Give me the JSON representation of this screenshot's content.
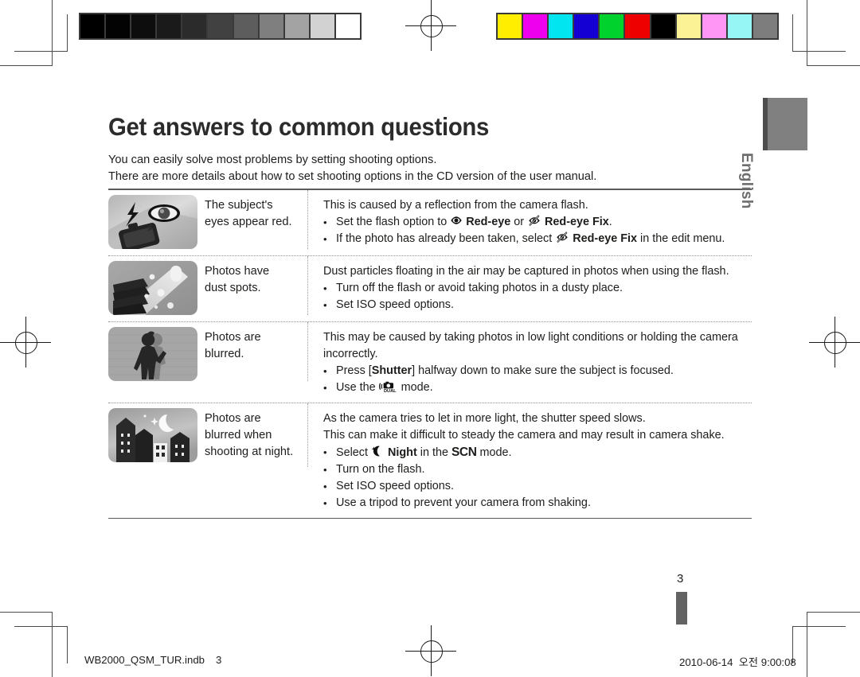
{
  "document": {
    "title": "Get answers to common questions",
    "intro_lines": [
      "You can easily solve most problems by setting shooting options.",
      "There are more details about how to set shooting options in the CD version of the user manual."
    ],
    "page_number": "3",
    "side_tab_label": "English"
  },
  "footer": {
    "filename": "WB2000_QSM_TUR.indb",
    "file_page": "3",
    "date": "2010-06-14",
    "meridiem": "오전",
    "time": "9:00:08"
  },
  "calibration": {
    "grayscale_label": "grayscale-calibration-strip",
    "grayscale_patches": [
      "#000000",
      "#030303",
      "#0d0d0d",
      "#1a1a1a",
      "#2b2b2b",
      "#414141",
      "#5d5d5d",
      "#7f7f7f",
      "#a3a3a3",
      "#d2d2d2",
      "#ffffff"
    ],
    "color_label": "color-calibration-strip",
    "color_patches": [
      "#ffee00",
      "#ee00ee",
      "#00e5f0",
      "#1400d2",
      "#00d22d",
      "#ee0000",
      "#000000",
      "#fbf295",
      "#ff96f5",
      "#96f5f5",
      "#7d7d7d"
    ]
  },
  "table": {
    "rows": [
      {
        "icon_name": "red-eye-photo-thumbnail",
        "label": [
          "The subject's",
          "eyes appear red."
        ],
        "lead": "This is caused by a reflection from the camera flash.",
        "bullets": [
          {
            "parts": [
              {
                "t": "text",
                "v": "Set the flash option to "
              },
              {
                "t": "icon",
                "v": "red-eye-icon"
              },
              {
                "t": "bold",
                "v": "Red-eye"
              },
              {
                "t": "text",
                "v": " or "
              },
              {
                "t": "icon",
                "v": "red-eye-fix-icon"
              },
              {
                "t": "bold",
                "v": "Red-eye Fix"
              },
              {
                "t": "text",
                "v": "."
              }
            ]
          },
          {
            "parts": [
              {
                "t": "text",
                "v": "If the photo has already been taken, select "
              },
              {
                "t": "icon",
                "v": "red-eye-fix-icon"
              },
              {
                "t": "bold",
                "v": "Red-eye Fix"
              },
              {
                "t": "text",
                "v": " in the edit menu."
              }
            ]
          }
        ]
      },
      {
        "icon_name": "dust-spots-photo-thumbnail",
        "label": [
          "Photos have",
          "dust spots."
        ],
        "lead": "Dust particles floating in the air may be captured in photos when using the flash.",
        "bullets": [
          {
            "parts": [
              {
                "t": "text",
                "v": "Turn off the flash or avoid taking photos in a dusty place."
              }
            ]
          },
          {
            "parts": [
              {
                "t": "text",
                "v": "Set ISO speed options."
              }
            ]
          }
        ]
      },
      {
        "icon_name": "blurred-photo-thumbnail",
        "label": [
          "Photos are",
          "blurred."
        ],
        "lead": "This may be caused by taking photos in low light conditions or holding the camera",
        "lead2": "incorrectly.",
        "bullets": [
          {
            "parts": [
              {
                "t": "text",
                "v": "Press ["
              },
              {
                "t": "bold",
                "v": "Shutter"
              },
              {
                "t": "text",
                "v": "] halfway down to make sure the subject is focused."
              }
            ]
          },
          {
            "parts": [
              {
                "t": "text",
                "v": "Use the "
              },
              {
                "t": "icon",
                "v": "dual-is-icon"
              },
              {
                "t": "text",
                "v": " mode."
              }
            ]
          }
        ]
      },
      {
        "icon_name": "night-scene-photo-thumbnail",
        "label": [
          "Photos are",
          "blurred when",
          "shooting at night."
        ],
        "lead": "As the camera tries to let in more light, the shutter speed slows.",
        "lead2": "This can make it difficult to steady the camera and may result in camera shake.",
        "bullets": [
          {
            "parts": [
              {
                "t": "text",
                "v": "Select "
              },
              {
                "t": "icon",
                "v": "night-mode-icon"
              },
              {
                "t": "bold",
                "v": "Night"
              },
              {
                "t": "text",
                "v": " in the "
              },
              {
                "t": "scn",
                "v": "SCN"
              },
              {
                "t": "text",
                "v": " mode."
              }
            ]
          },
          {
            "parts": [
              {
                "t": "text",
                "v": "Turn on the flash."
              }
            ]
          },
          {
            "parts": [
              {
                "t": "text",
                "v": "Set ISO speed options."
              }
            ]
          },
          {
            "parts": [
              {
                "t": "text",
                "v": "Use a tripod to prevent your camera from shaking."
              }
            ]
          }
        ]
      }
    ]
  }
}
